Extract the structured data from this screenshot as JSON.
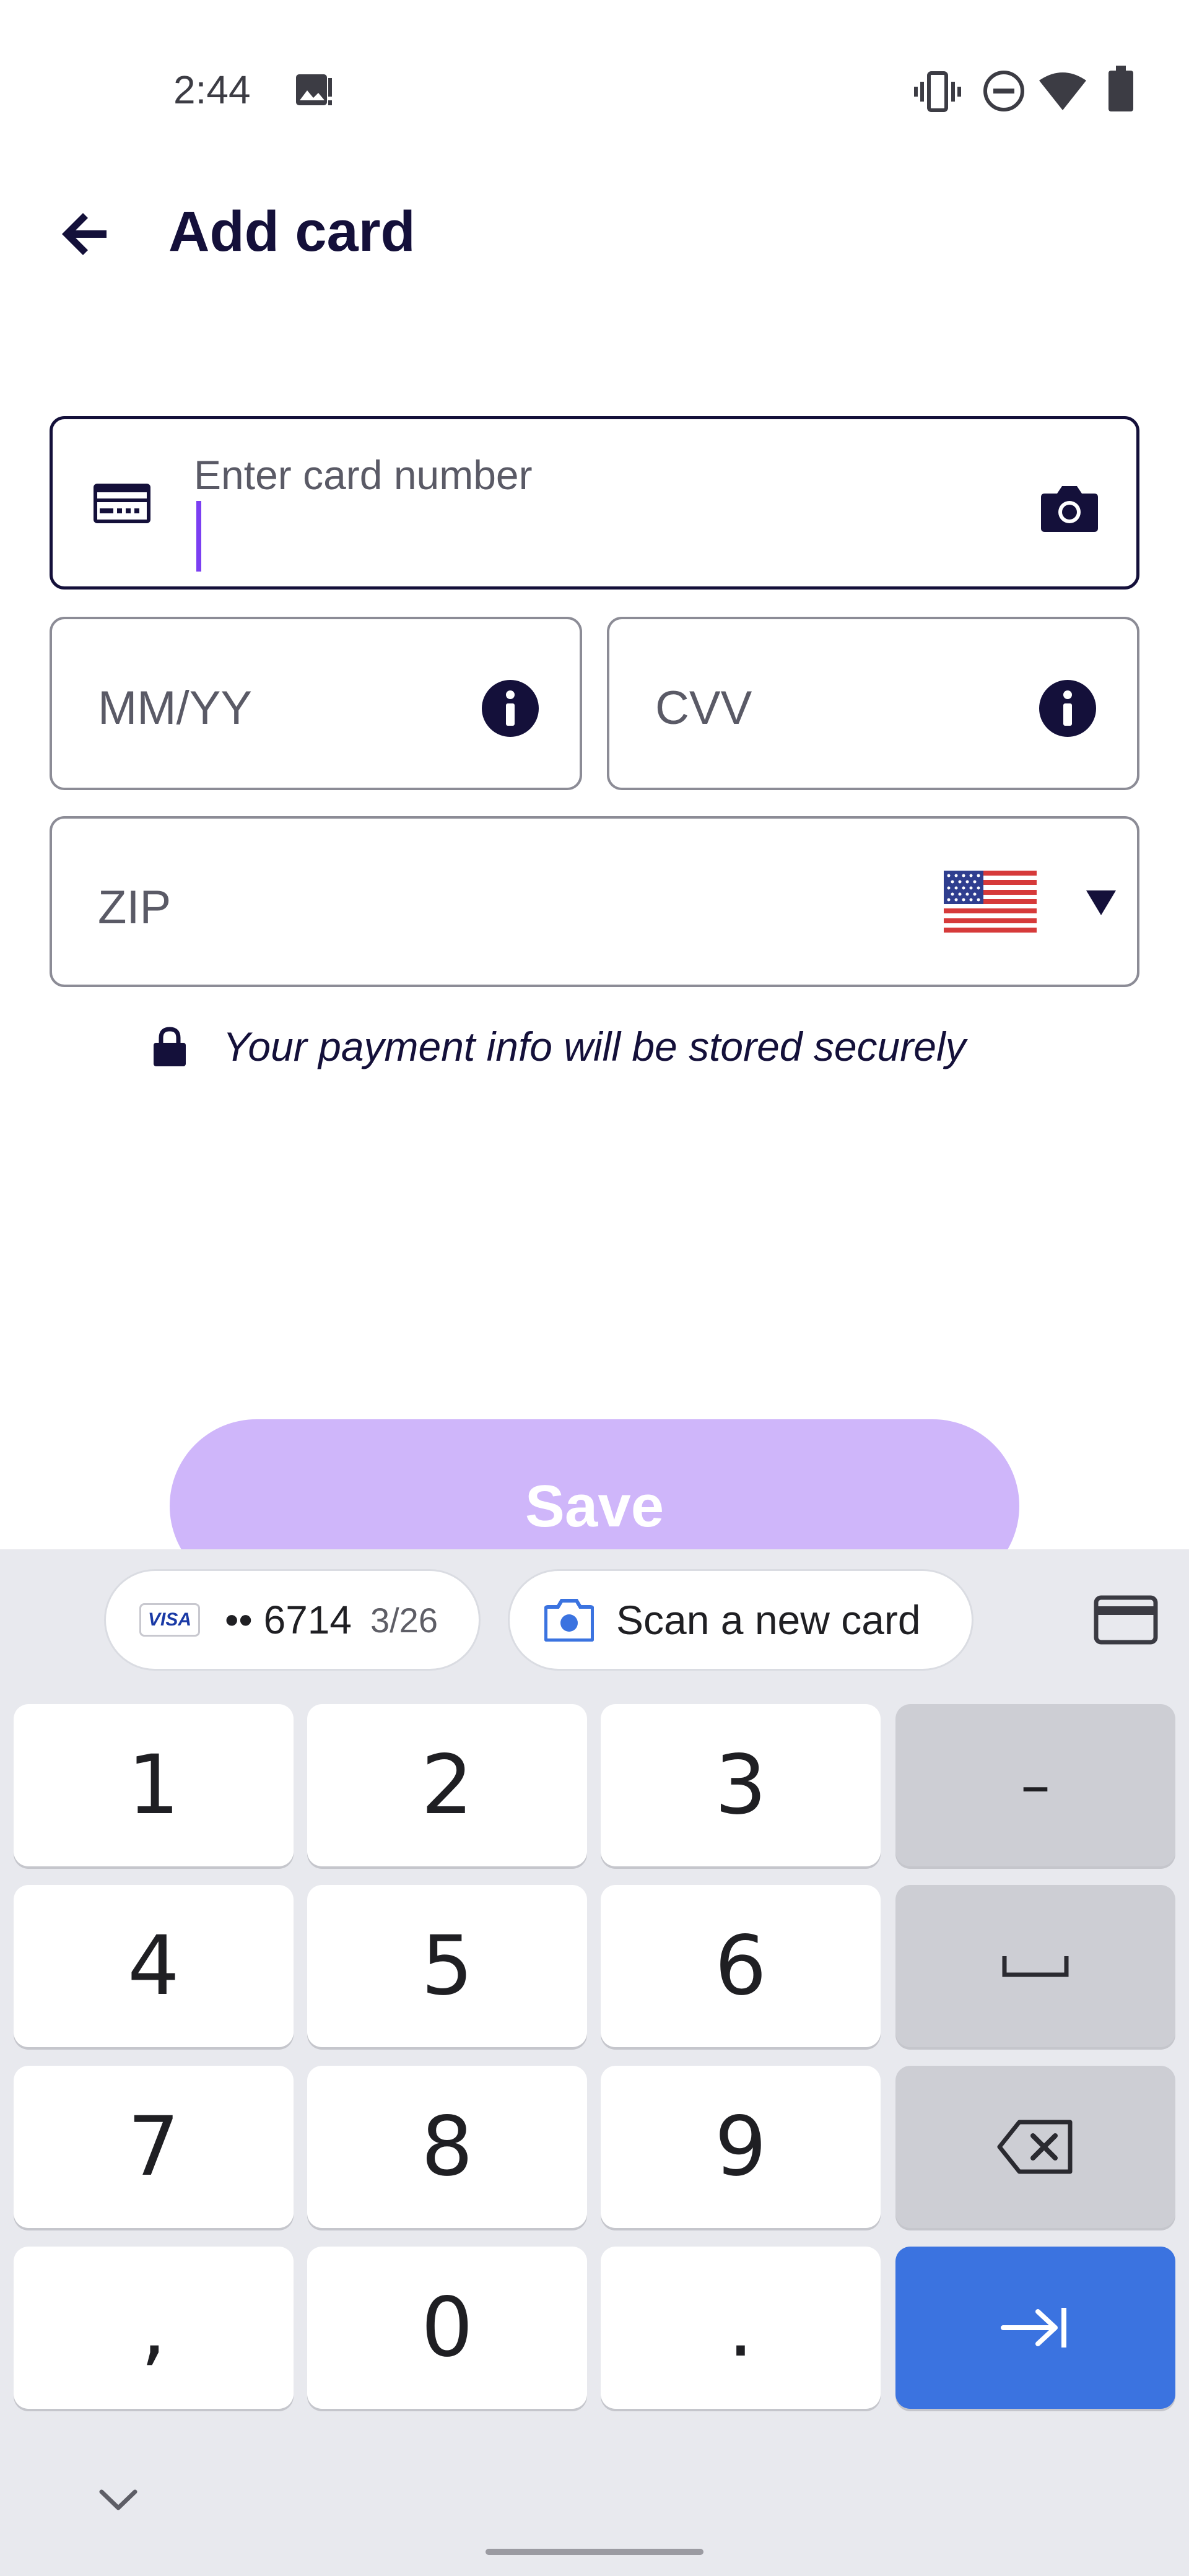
{
  "status_bar": {
    "time": "2:44",
    "icons": [
      "image-notification-icon",
      "vibrate-icon",
      "do-not-disturb-icon",
      "wifi-icon",
      "battery-icon"
    ]
  },
  "app_bar": {
    "title": "Add card",
    "back_icon": "arrow-left-icon"
  },
  "form": {
    "card_number": {
      "label": "Enter card number",
      "value": "",
      "icon": "credit-card-icon",
      "action_icon": "camera-icon"
    },
    "expiry": {
      "placeholder": "MM/YY",
      "value": "",
      "icon": "info-icon"
    },
    "cvv": {
      "placeholder": "CVV",
      "value": "",
      "icon": "info-icon"
    },
    "zip": {
      "placeholder": "ZIP",
      "value": "",
      "country_icon": "us-flag-icon",
      "dropdown_icon": "triangle-down-icon"
    },
    "secure_note": "Your payment info will be stored securely"
  },
  "save_button": {
    "label": "Save",
    "color": "#cfb6fa"
  },
  "keyboard": {
    "suggestions": [
      {
        "brand": "VISA",
        "number": "•• 6714",
        "expiry": "3/26"
      },
      {
        "label": "Scan a new card",
        "icon": "camera-icon"
      }
    ],
    "keys": [
      [
        "1",
        "2",
        "3",
        "–"
      ],
      [
        "4",
        "5",
        "6",
        "␣"
      ],
      [
        "7",
        "8",
        "9",
        "⌫"
      ],
      [
        ",",
        "0",
        ".",
        "⇥"
      ]
    ],
    "action_key_color": "#3b73e0"
  },
  "colors": {
    "text_primary": "#14103a",
    "caret": "#7b3ff2",
    "field_border": "#8c8c96"
  }
}
